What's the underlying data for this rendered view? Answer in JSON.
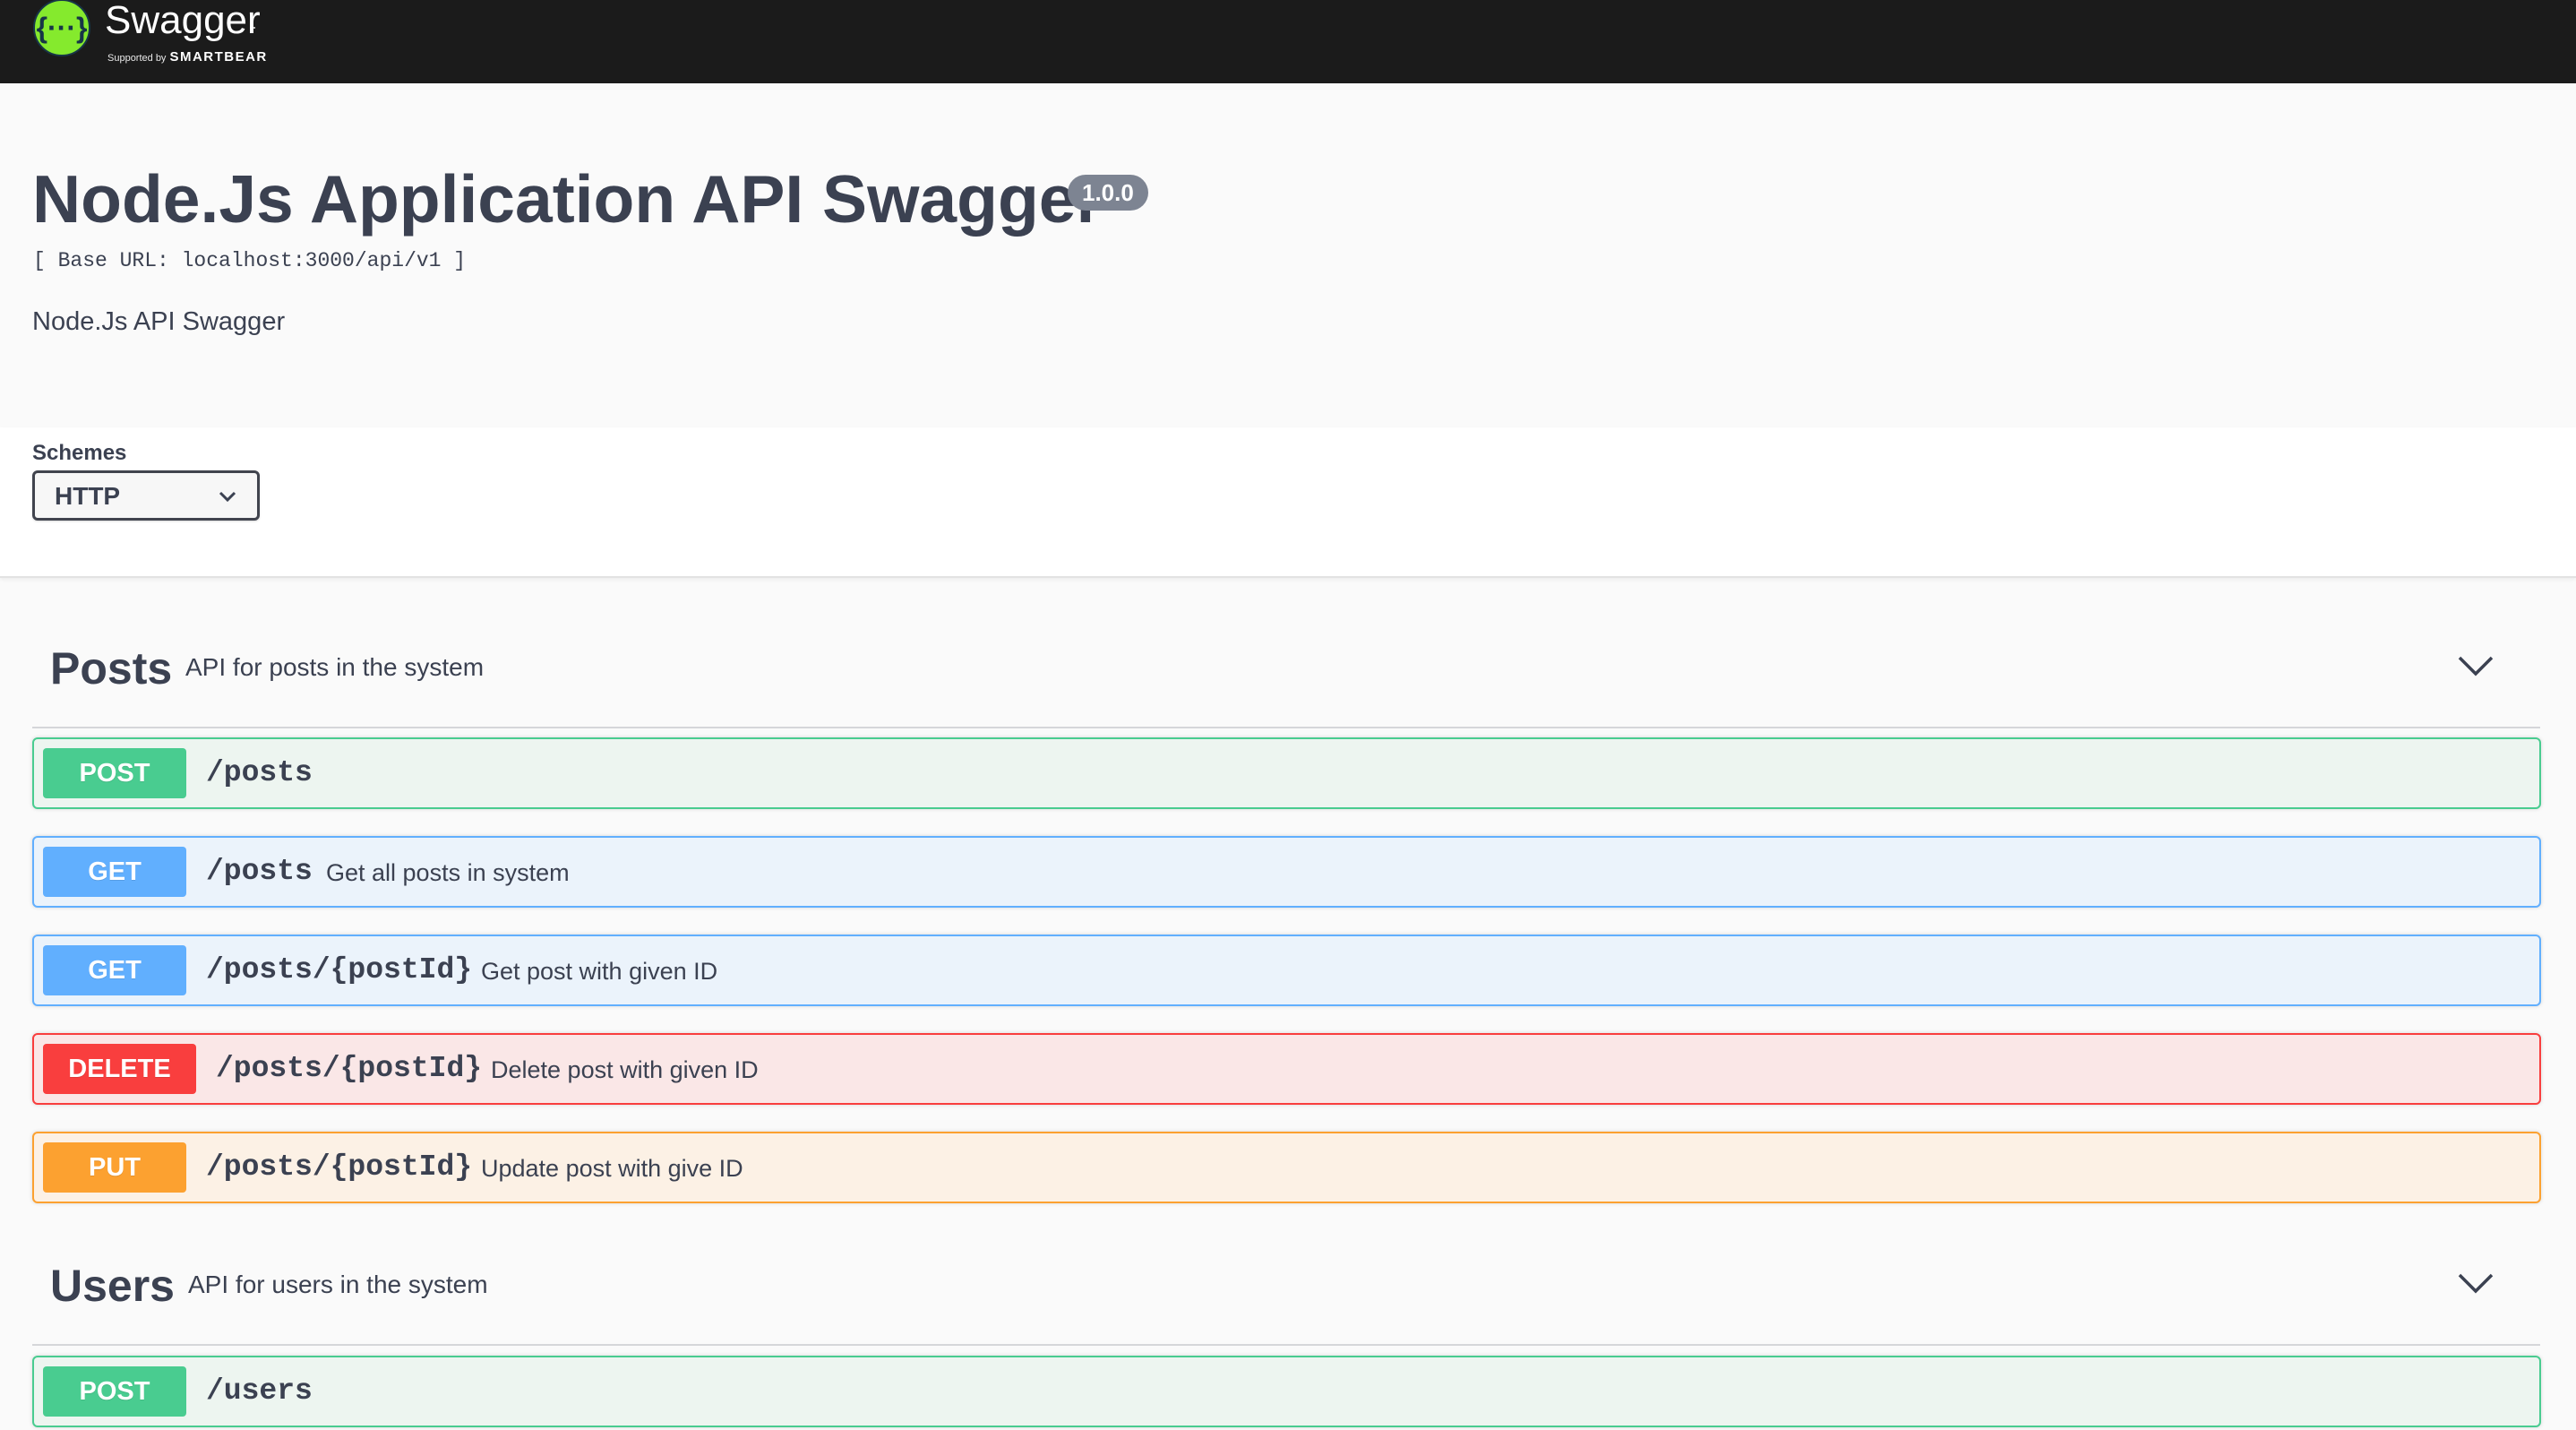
{
  "topbar": {
    "logo_text": "Swagger",
    "supported_by": "Supported by",
    "smartbear": "SMARTBEAR",
    "logo_icon": "braces-dots-icon"
  },
  "info": {
    "title": "Node.Js Application API Swagger",
    "version": "1.0.0",
    "base_url": "[ Base URL: localhost:3000/api/v1 ]",
    "description": "Node.Js API Swagger"
  },
  "schemes": {
    "label": "Schemes",
    "selected": "HTTP"
  },
  "tags": [
    {
      "name": "Posts",
      "description": "API for posts in the system",
      "operations": [
        {
          "method": "POST",
          "path": "/posts",
          "summary": ""
        },
        {
          "method": "GET",
          "path": "/posts",
          "summary": "Get all posts in system"
        },
        {
          "method": "GET",
          "path": "/posts/{postId}",
          "summary": "Get post with given ID"
        },
        {
          "method": "DELETE",
          "path": "/posts/{postId}",
          "summary": "Delete post with given ID"
        },
        {
          "method": "PUT",
          "path": "/posts/{postId}",
          "summary": "Update post with give ID"
        }
      ]
    },
    {
      "name": "Users",
      "description": "API for users in the system",
      "operations": [
        {
          "method": "POST",
          "path": "/users",
          "summary": ""
        }
      ]
    }
  ],
  "colors": {
    "topbar": "#1b1b1b",
    "post": "#49cc90",
    "get": "#61affe",
    "delete": "#f93e3e",
    "put": "#fca130",
    "logo_green": "#85ea2d"
  }
}
